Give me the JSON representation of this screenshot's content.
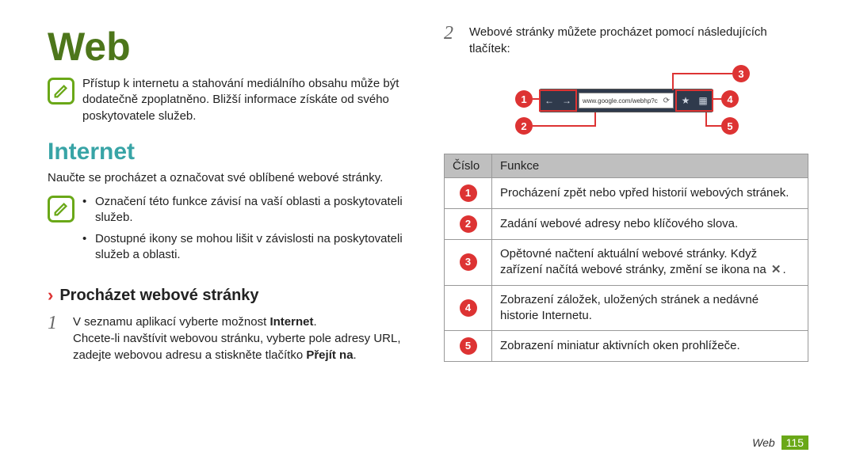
{
  "title": "Web",
  "note1": "Přístup k internetu a stahování mediálního obsahu může být dodatečně zpoplatněno. Bližší informace získáte od svého poskytovatele služeb.",
  "section": "Internet",
  "intro": "Naučte se procházet a označovat své oblíbené webové stránky.",
  "note2_items": [
    "Označení této funkce závisí na vaší oblasti a poskytovateli služeb.",
    "Dostupné ikony se mohou lišit v závislosti na poskytovateli služeb a oblasti."
  ],
  "subheading": "Procházet webové stránky",
  "step1_num": "1",
  "step1_a": "V seznamu aplikací vyberte možnost ",
  "step1_a_strong": "Internet",
  "step1_a_tail": ".",
  "step1_b_a": "Chcete-li navštívit webovou stránku, vyberte pole adresy URL, zadejte webovou adresu a stiskněte tlačítko ",
  "step1_b_strong": "Přejít na",
  "step1_b_tail": ".",
  "step2_num": "2",
  "step2_text": "Webové stránky můžete procházet pomocí následujících tlačítek:",
  "toolbar_url": "www.google.com/webhp?c",
  "badge1": "1",
  "badge2": "2",
  "badge3": "3",
  "badge4": "4",
  "badge5": "5",
  "table": {
    "col_num": "Číslo",
    "col_func": "Funkce",
    "rows": [
      {
        "n": "1",
        "t": "Procházení zpět nebo vpřed historií webových stránek."
      },
      {
        "n": "2",
        "t": "Zadání webové adresy nebo klíčového slova."
      },
      {
        "n": "3",
        "t_a": "Opětovné načtení aktuální webové stránky. Když zařízení načítá webové stránky, změní se ikona na ",
        "t_b": "."
      },
      {
        "n": "4",
        "t": "Zobrazení záložek, uložených stránek a nedávné historie Internetu."
      },
      {
        "n": "5",
        "t": "Zobrazení miniatur aktivních oken prohlížeče."
      }
    ]
  },
  "footer_section": "Web",
  "footer_page": "115"
}
